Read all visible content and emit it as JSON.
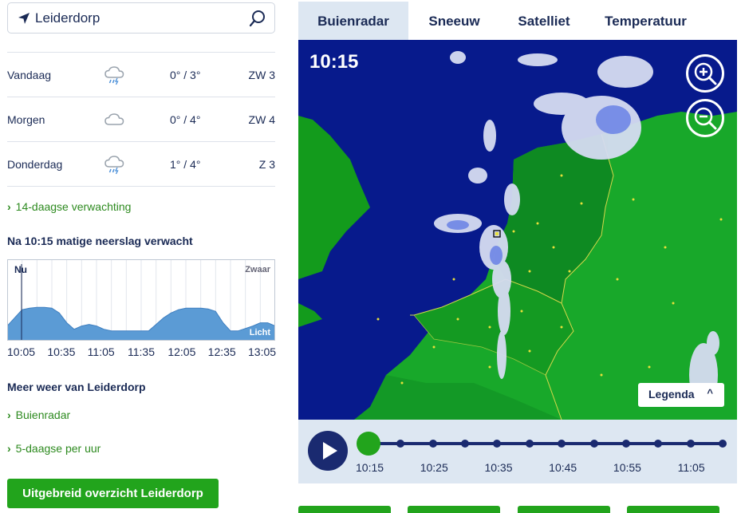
{
  "search": {
    "value": "Leiderdorp"
  },
  "forecast": [
    {
      "day": "Vandaag",
      "icon": "rain-cloud-icon",
      "temp": "0° / 3°",
      "wind": "ZW 3"
    },
    {
      "day": "Morgen",
      "icon": "cloud-icon",
      "temp": "0° / 4°",
      "wind": "ZW 4"
    },
    {
      "day": "Donderdag",
      "icon": "rain-cloud-icon",
      "temp": "1° / 4°",
      "wind": "Z 3"
    }
  ],
  "links": {
    "fourteen_day": "14-daagse verwachting",
    "buienradar": "Buienradar",
    "five_day_hourly": "5-daagse per uur"
  },
  "precip_heading": "Na 10:15 matige neerslag verwacht",
  "more_weather_heading": "Meer weer van Leiderdorp",
  "overview_button": "Uitgebreid overzicht Leiderdorp",
  "chart_data": {
    "type": "area",
    "title": "Na 10:15 matige neerslag verwacht",
    "x_ticks": [
      "10:05",
      "10:35",
      "11:05",
      "11:35",
      "12:05",
      "12:35",
      "13:05"
    ],
    "x": [
      "10:05",
      "10:10",
      "10:15",
      "10:20",
      "10:25",
      "10:30",
      "10:35",
      "10:40",
      "10:45",
      "10:50",
      "10:55",
      "11:00",
      "11:05",
      "11:10",
      "11:15",
      "11:20",
      "11:25",
      "11:30",
      "11:35",
      "11:40",
      "11:45",
      "11:50",
      "11:55",
      "12:00",
      "12:05",
      "12:10",
      "12:15",
      "12:20",
      "12:25",
      "12:30",
      "12:35",
      "12:40",
      "12:45",
      "12:50",
      "12:55",
      "13:00",
      "13:05"
    ],
    "values": [
      0.18,
      0.28,
      0.38,
      0.4,
      0.41,
      0.41,
      0.4,
      0.34,
      0.22,
      0.14,
      0.18,
      0.2,
      0.18,
      0.14,
      0.12,
      0.12,
      0.12,
      0.12,
      0.12,
      0.12,
      0.2,
      0.28,
      0.34,
      0.38,
      0.4,
      0.4,
      0.4,
      0.39,
      0.36,
      0.22,
      0.12,
      0.12,
      0.15,
      0.18,
      0.22,
      0.22,
      0.18
    ],
    "ylim": [
      0,
      1
    ],
    "now_label": "Nu",
    "top_label": "Zwaar",
    "bottom_label": "Licht",
    "grid": true,
    "fill_color": "#5b9bd5"
  },
  "tabs": [
    "Buienradar",
    "Sneeuw",
    "Satelliet",
    "Temperatuur"
  ],
  "map": {
    "time": "10:15",
    "legend_label": "Legenda",
    "zoom_in_icon": "zoom-in-icon",
    "zoom_out_icon": "zoom-out-icon"
  },
  "timeline": {
    "labels": [
      "10:15",
      "10:25",
      "10:35",
      "10:45",
      "10:55",
      "11:05"
    ],
    "steps": 11,
    "current_step": 0
  },
  "colors": {
    "accent_green": "#22a41c",
    "navy": "#1a2a70",
    "text": "#1a2a55"
  }
}
